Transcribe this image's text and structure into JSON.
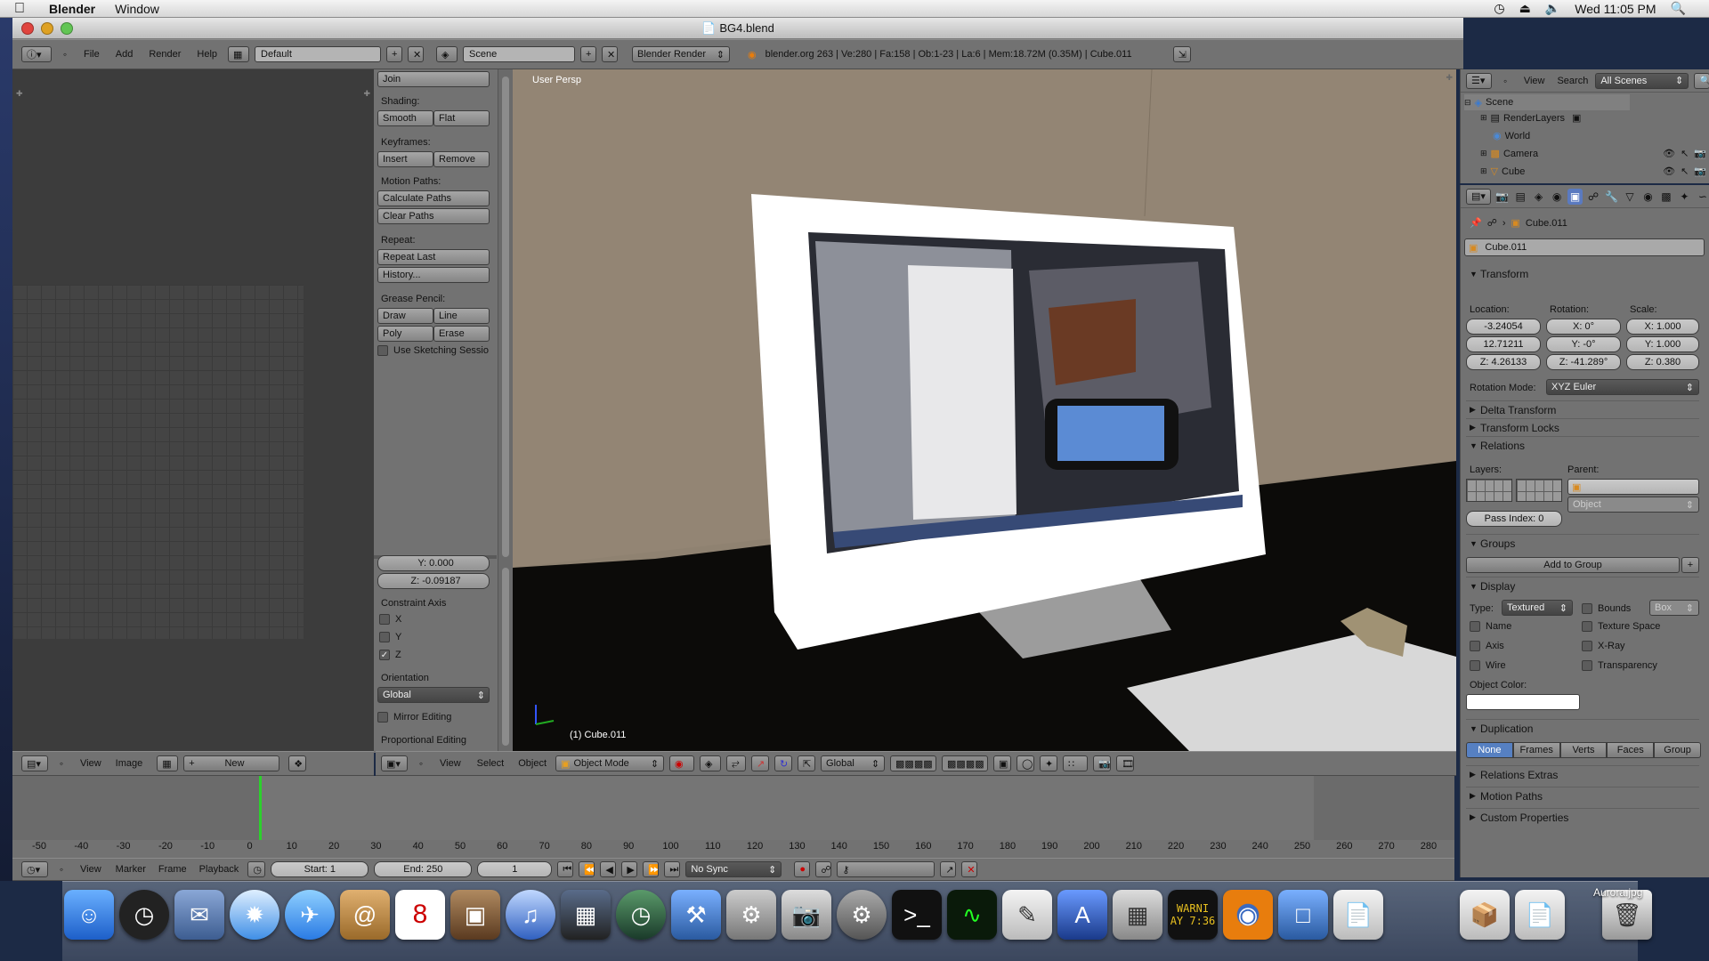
{
  "menubar": {
    "app_name": "Blender",
    "window_menu": "Window",
    "clock": "Wed 11:05 PM"
  },
  "window": {
    "title": "BG4.blend"
  },
  "info_header": {
    "menus": [
      "File",
      "Add",
      "Render",
      "Help"
    ],
    "layout": "Default",
    "scene": "Scene",
    "engine": "Blender Render",
    "stats": "blender.org 263 | Ve:280 | Fa:158 | Ob:1-23 | La:6 | Mem:18.72M (0.35M) | Cube.011"
  },
  "tool_panel": {
    "join": "Join",
    "shading_label": "Shading:",
    "smooth": "Smooth",
    "flat": "Flat",
    "keyframes_label": "Keyframes:",
    "insert": "Insert",
    "remove": "Remove",
    "motion_paths_label": "Motion Paths:",
    "calculate_paths": "Calculate Paths",
    "clear_paths": "Clear Paths",
    "repeat_label": "Repeat:",
    "repeat_last": "Repeat Last",
    "history": "History...",
    "grease_pencil_label": "Grease Pencil:",
    "draw": "Draw",
    "line": "Line",
    "poly": "Poly",
    "erase": "Erase",
    "use_sketching": "Use Sketching Sessio",
    "y_value": "Y: 0.000",
    "z_value": "Z: -0.09187",
    "constraint_axis_label": "Constraint Axis",
    "axis_x": "X",
    "axis_y": "Y",
    "axis_z": "Z",
    "orientation_label": "Orientation",
    "orientation": "Global",
    "mirror_editing": "Mirror Editing",
    "proportional_editing": "Proportional Editing"
  },
  "viewport": {
    "view_label": "User Persp",
    "object_label": "(1) Cube.011",
    "header_menus": [
      "View",
      "Select",
      "Object"
    ],
    "mode": "Object Mode",
    "orientation": "Global"
  },
  "image_editor_header": {
    "menus": [
      "View",
      "Image"
    ],
    "new": "New"
  },
  "outliner": {
    "menus": [
      "View",
      "Search"
    ],
    "filter": "All Scenes",
    "items": [
      "Scene",
      "RenderLayers",
      "World",
      "Camera",
      "Cube"
    ]
  },
  "properties": {
    "object_path": "Cube.011",
    "object_name": "Cube.011",
    "transform_label": "Transform",
    "location_label": "Location:",
    "rotation_label": "Rotation:",
    "scale_label": "Scale:",
    "loc": [
      "-3.24054",
      "12.71211",
      "Z: 4.26133"
    ],
    "rot": [
      "X: 0°",
      "Y: -0°",
      "Z: -41.289°"
    ],
    "scale": [
      "X: 1.000",
      "Y: 1.000",
      "Z: 0.380"
    ],
    "rotation_mode_label": "Rotation Mode:",
    "rotation_mode": "XYZ Euler",
    "delta_transform": "Delta Transform",
    "transform_locks": "Transform Locks",
    "relations": "Relations",
    "layers_label": "Layers:",
    "parent_label": "Parent:",
    "parent_type": "Object",
    "pass_index": "Pass Index: 0",
    "groups": "Groups",
    "add_to_group": "Add to Group",
    "display": "Display",
    "type_label": "Type:",
    "type_value": "Textured",
    "bounds": "Bounds",
    "bounds_type": "Box",
    "name": "Name",
    "texture_space": "Texture Space",
    "axis": "Axis",
    "xray": "X-Ray",
    "wire": "Wire",
    "transparency": "Transparency",
    "object_color_label": "Object Color:",
    "duplication": "Duplication",
    "dup_tabs": [
      "None",
      "Frames",
      "Verts",
      "Faces",
      "Group"
    ],
    "relations_extras": "Relations Extras",
    "motion_paths": "Motion Paths",
    "custom_properties": "Custom Properties"
  },
  "timeline": {
    "ticks": [
      "-50",
      "-40",
      "-30",
      "-20",
      "-10",
      "0",
      "10",
      "20",
      "30",
      "40",
      "50",
      "60",
      "70",
      "80",
      "90",
      "100",
      "110",
      "120",
      "130",
      "140",
      "150",
      "160",
      "170",
      "180",
      "190",
      "200",
      "210",
      "220",
      "230",
      "240",
      "250",
      "260",
      "270",
      "280"
    ],
    "menus": [
      "View",
      "Marker",
      "Frame",
      "Playback"
    ],
    "start": "Start: 1",
    "end": "End: 250",
    "current": "1",
    "sync": "No Sync"
  },
  "desktop": {
    "file_label": "Aurora.jpg",
    "warning_label": "WARNI\nAY 7:36"
  }
}
